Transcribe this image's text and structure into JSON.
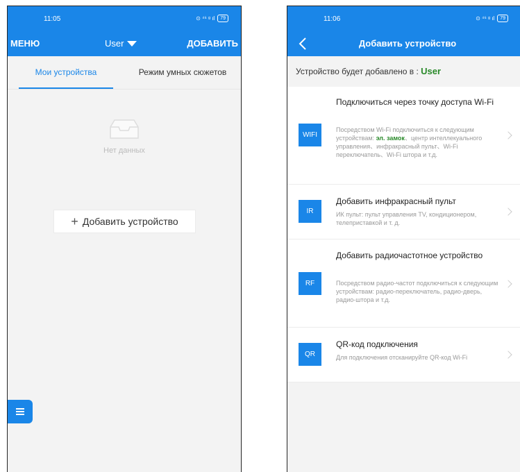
{
  "left": {
    "status": {
      "time": "11:05",
      "icons": "⊙ ⁴⁶ ᵍ ıl",
      "battery": "79"
    },
    "nav": {
      "menu": "МЕНЮ",
      "user": "User",
      "add": "ДОБАВИТЬ"
    },
    "tabs": [
      {
        "label": "Мои устройства"
      },
      {
        "label": "Режим умных сюжетов"
      }
    ],
    "empty_text": "Нет данных",
    "add_device": {
      "plus": "+",
      "label": "Добавить устройство"
    }
  },
  "right": {
    "status": {
      "time": "11:06",
      "icons": "⊙ ⁴⁶ ᵍ ıl",
      "battery": "79"
    },
    "nav": {
      "title": "Добавить устройство"
    },
    "target": {
      "prefix": "Устройство будет добавлено в : ",
      "user": "User"
    },
    "items": [
      {
        "badge": "WIFI",
        "title": "Подключиться через точку доступа Wi-Fi",
        "desc_pre": "Посредством Wi-Fi подключиться к следующим устройствам: ",
        "desc_hl": "эл. замок",
        "desc_post": "、центр интеллекуального управления、инфракрасный пульт、Wi-Fi переключатель、Wi-Fi штора и т.д."
      },
      {
        "badge": "IR",
        "title": "Добавить инфракрасный пульт",
        "desc": "ИК пульт: пульт управления TV, кондиционером, телеприставкой и т. д."
      },
      {
        "badge": "RF",
        "title": "Добавить радиочастотное устройство",
        "desc": "Посредством радио-частот подключиться к следующим устройствам: радио-переключатель, радио-дверь, радио-штора и т.д."
      },
      {
        "badge": "QR",
        "title": "QR-код подключения",
        "desc": "Для подключения отсканируйте QR-код Wi-Fi"
      }
    ]
  },
  "colors": {
    "primary": "#1a86e8",
    "highlight": "#2a8a2a",
    "background": "#f3f3f3"
  },
  "icons": [
    "dropdown-triangle-icon",
    "empty-inbox-icon",
    "plus-icon",
    "menu-bars-icon",
    "back-arrow-icon",
    "chevron-right-icon"
  ]
}
